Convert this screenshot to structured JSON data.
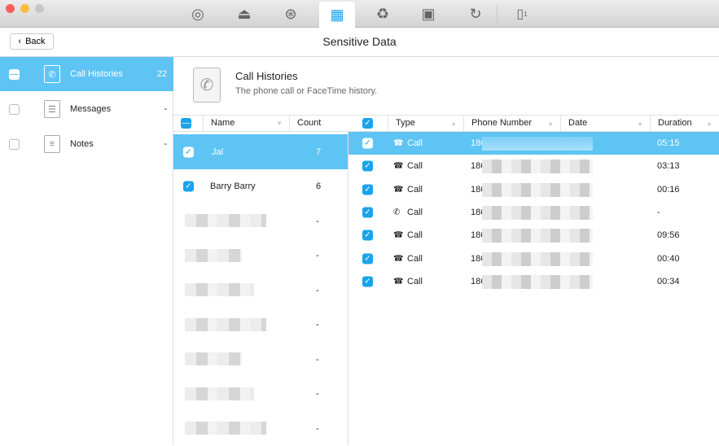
{
  "window": {
    "toolbar_icons": [
      "airplay-icon",
      "cleanup-broom-icon",
      "internet-globe-icon",
      "privacy-shredder-icon",
      "trash-icon",
      "toolbox-icon",
      "restore-icon",
      "device-icon"
    ],
    "device_badge": "1",
    "accent": "#5ec4f4"
  },
  "header": {
    "back_label": "Back",
    "title": "Sensitive Data"
  },
  "sidebar": {
    "items": [
      {
        "label": "Call Histories",
        "count": "22",
        "icon": "phone-document-icon",
        "checked": "partial",
        "selected": true
      },
      {
        "label": "Messages",
        "count": "-",
        "icon": "message-icon",
        "checked": false
      },
      {
        "label": "Notes",
        "count": "-",
        "icon": "notes-icon",
        "checked": false
      }
    ]
  },
  "info": {
    "title": "Call Histories",
    "subtitle": "The phone call or FaceTime history."
  },
  "contacts": {
    "columns": {
      "name": "Name",
      "count": "Count"
    },
    "rows": [
      {
        "name": "Jal",
        "count": "7"
      },
      {
        "name": "Barry Barry",
        "count": "6"
      },
      {
        "name": "",
        "count": "-"
      },
      {
        "name": "",
        "count": "-"
      },
      {
        "name": "",
        "count": "-"
      },
      {
        "name": "",
        "count": "-"
      },
      {
        "name": "",
        "count": "-"
      },
      {
        "name": "",
        "count": "-"
      },
      {
        "name": "",
        "count": "-"
      }
    ]
  },
  "calls": {
    "columns": {
      "type": "Type",
      "phone": "Phone Number",
      "date": "Date",
      "duration": "Duration"
    },
    "rows": [
      {
        "type": "Call",
        "phone": "186",
        "duration": "05:15"
      },
      {
        "type": "Call",
        "phone": "186",
        "duration": "03:13"
      },
      {
        "type": "Call",
        "phone": "186",
        "duration": "00:16"
      },
      {
        "type": "Call",
        "phone": "186",
        "duration": "-"
      },
      {
        "type": "Call",
        "phone": "186",
        "duration": "09:56"
      },
      {
        "type": "Call",
        "phone": "186",
        "duration": "00:40"
      },
      {
        "type": "Call",
        "phone": "186",
        "duration": "00:34"
      }
    ]
  }
}
